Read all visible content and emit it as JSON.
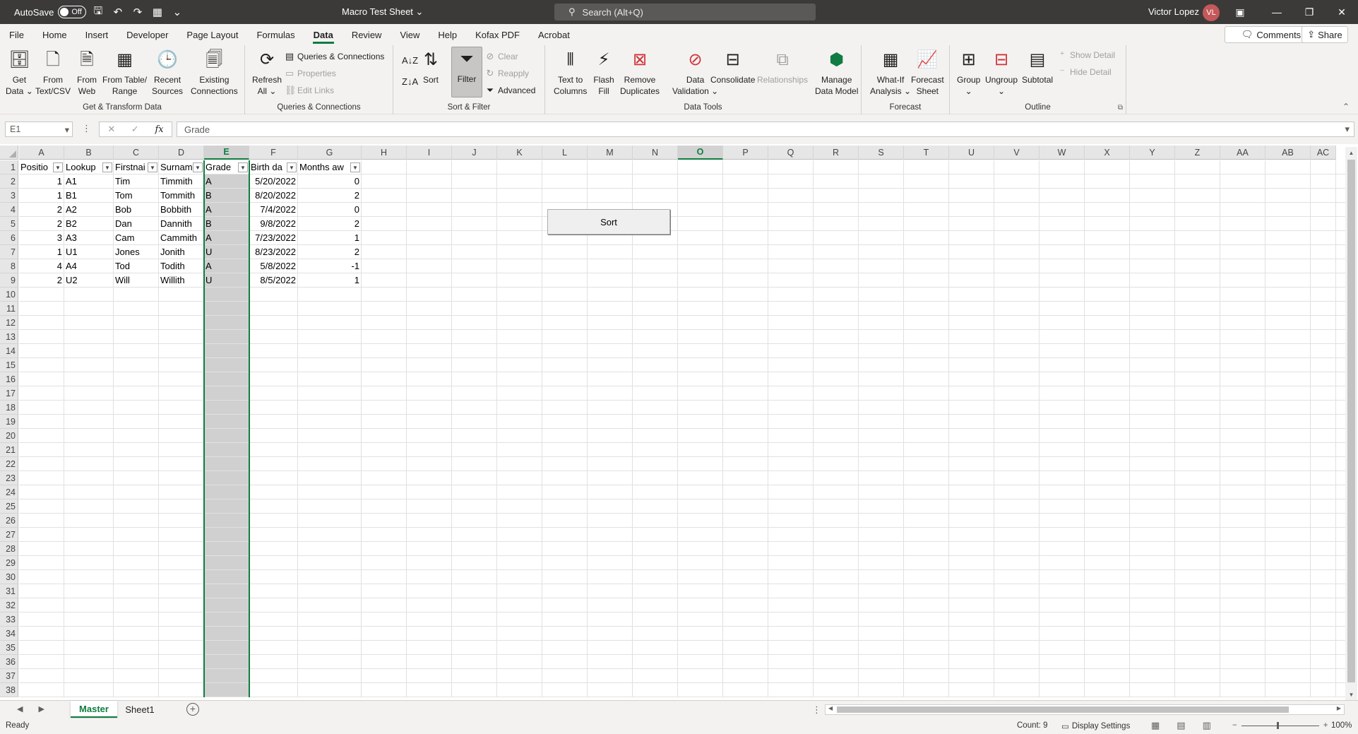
{
  "titlebar": {
    "autosave_label": "AutoSave",
    "autosave_state": "Off",
    "doc_title": "Macro Test Sheet",
    "search_placeholder": "Search (Alt+Q)",
    "user_name": "Victor Lopez",
    "user_initials": "VL"
  },
  "menu": {
    "tabs": [
      "File",
      "Home",
      "Insert",
      "Developer",
      "Page Layout",
      "Formulas",
      "Data",
      "Review",
      "View",
      "Help",
      "Kofax PDF",
      "Acrobat"
    ],
    "active_tab": "Data",
    "comments_label": "Comments",
    "share_label": "Share"
  },
  "ribbon": {
    "get_transform": {
      "name": "Get & Transform Data",
      "get_data": [
        "Get",
        "Data"
      ],
      "from_text": [
        "From",
        "Text/CSV"
      ],
      "from_web": [
        "From",
        "Web"
      ],
      "from_table": [
        "From Table/",
        "Range"
      ],
      "recent_sources": [
        "Recent",
        "Sources"
      ],
      "existing_connections": [
        "Existing",
        "Connections"
      ]
    },
    "queries": {
      "name": "Queries & Connections",
      "refresh": [
        "Refresh",
        "All"
      ],
      "queries_connections": "Queries & Connections",
      "properties": "Properties",
      "edit_links": "Edit Links"
    },
    "sort_filter": {
      "name": "Sort & Filter",
      "sort": "Sort",
      "filter": "Filter",
      "clear": "Clear",
      "reapply": "Reapply",
      "advanced": "Advanced"
    },
    "data_tools": {
      "name": "Data Tools",
      "text_to_columns": [
        "Text to",
        "Columns"
      ],
      "flash_fill": [
        "Flash",
        "Fill"
      ],
      "remove_duplicates": [
        "Remove",
        "Duplicates"
      ],
      "data_validation": [
        "Data",
        "Validation"
      ],
      "consolidate": "Consolidate",
      "relationships": "Relationships",
      "manage_data_model": [
        "Manage",
        "Data Model"
      ]
    },
    "forecast": {
      "name": "Forecast",
      "what_if": [
        "What-If",
        "Analysis"
      ],
      "forecast_sheet": [
        "Forecast",
        "Sheet"
      ]
    },
    "outline": {
      "name": "Outline",
      "group": "Group",
      "ungroup": "Ungroup",
      "subtotal": "Subtotal",
      "show_detail": "Show Detail",
      "hide_detail": "Hide Detail"
    }
  },
  "formula_bar": {
    "name_box": "E1",
    "content": "Grade"
  },
  "grid": {
    "columns": [
      "A",
      "B",
      "C",
      "D",
      "E",
      "F",
      "G",
      "H",
      "I",
      "J",
      "K",
      "L",
      "M",
      "N",
      "O",
      "P",
      "Q",
      "R",
      "S",
      "T",
      "U",
      "V",
      "W",
      "X",
      "Y",
      "Z",
      "AA",
      "AB",
      "AC"
    ],
    "selected_column": "E",
    "active_column_header": "O",
    "row_count": 38,
    "headers": [
      "Positio",
      "Lookup",
      "Firstnai",
      "Surnam",
      "Grade",
      "Birth da",
      "Months aw"
    ],
    "rows": [
      [
        "1",
        "A1",
        "Tim",
        "Timmith",
        "A",
        "5/20/2022",
        "0"
      ],
      [
        "1",
        "B1",
        "Tom",
        "Tommith",
        "B",
        "8/20/2022",
        "2"
      ],
      [
        "2",
        "A2",
        "Bob",
        "Bobbith",
        "A",
        "7/4/2022",
        "0"
      ],
      [
        "2",
        "B2",
        "Dan",
        "Dannith",
        "B",
        "9/8/2022",
        "2"
      ],
      [
        "3",
        "A3",
        "Cam",
        "Cammith",
        "A",
        "7/23/2022",
        "1"
      ],
      [
        "1",
        "U1",
        "Jones",
        "Jonith",
        "U",
        "8/23/2022",
        "2"
      ],
      [
        "4",
        "A4",
        "Tod",
        "Todith",
        "A",
        "5/8/2022",
        "-1"
      ],
      [
        "2",
        "U2",
        "Will",
        "Willith",
        "U",
        "8/5/2022",
        "1"
      ]
    ],
    "sort_button_label": "Sort"
  },
  "sheets": {
    "tabs": [
      "Master",
      "Sheet1"
    ],
    "active": "Master"
  },
  "status": {
    "ready": "Ready",
    "count": "Count: 9",
    "display_settings": "Display Settings",
    "zoom": "100%"
  },
  "colors": {
    "accent": "#107c41",
    "titlebar": "#3b3a39"
  }
}
